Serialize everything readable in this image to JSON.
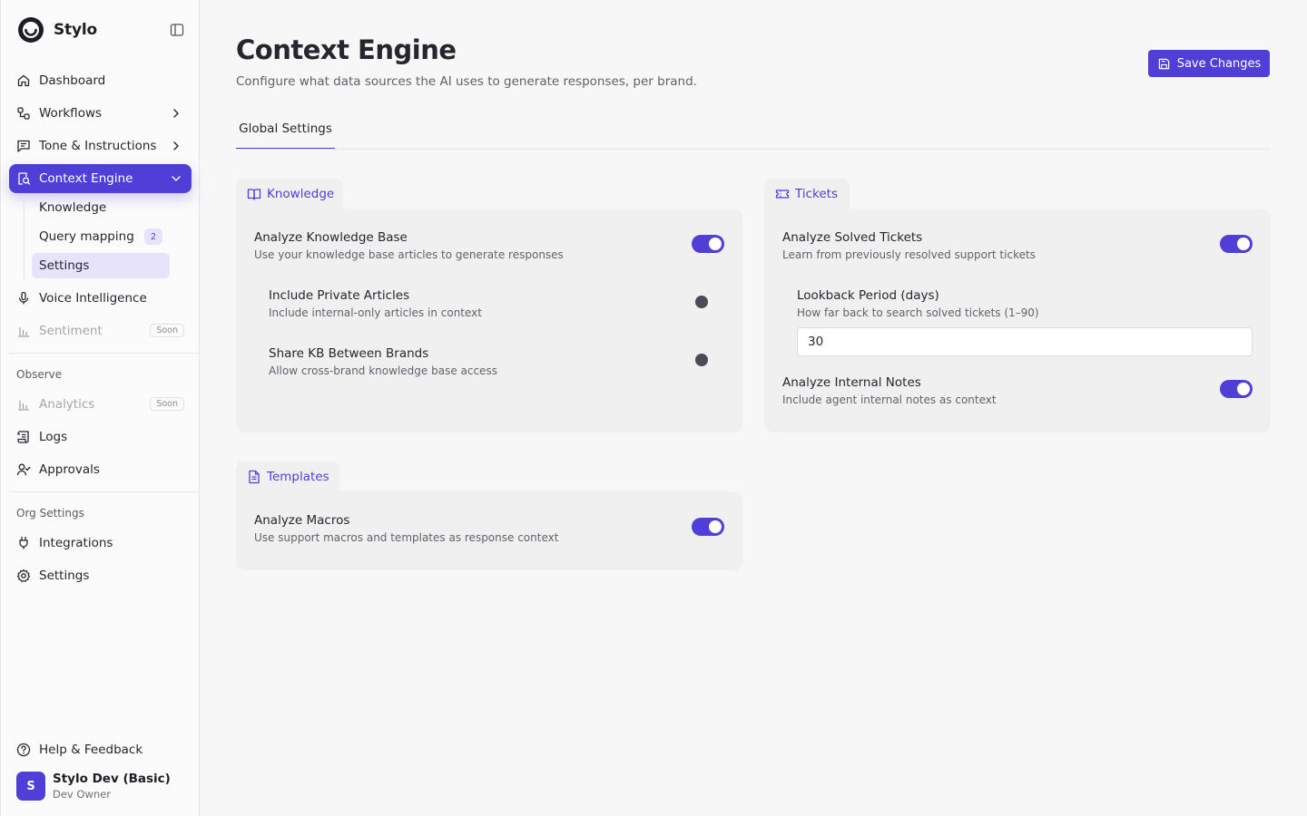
{
  "brand": {
    "name": "Stylo"
  },
  "sidebar": {
    "items": [
      {
        "label": "Dashboard"
      },
      {
        "label": "Workflows"
      },
      {
        "label": "Tone & Instructions"
      },
      {
        "label": "Context Engine"
      },
      {
        "label": "Voice Intelligence"
      },
      {
        "label": "Sentiment",
        "badge": "Soon"
      }
    ],
    "context_sub": [
      {
        "label": "Knowledge"
      },
      {
        "label": "Query mapping",
        "count": "2"
      },
      {
        "label": "Settings"
      }
    ],
    "observe_label": "Observe",
    "observe": [
      {
        "label": "Analytics",
        "badge": "Soon"
      },
      {
        "label": "Logs"
      },
      {
        "label": "Approvals"
      }
    ],
    "org_label": "Org Settings",
    "org": [
      {
        "label": "Integrations"
      },
      {
        "label": "Settings"
      }
    ],
    "help": "Help & Feedback",
    "user": {
      "initial": "S",
      "name": "Stylo Dev (Basic)",
      "role": "Dev Owner"
    }
  },
  "header": {
    "title": "Context Engine",
    "subtitle": "Configure what data sources the AI uses to generate responses, per brand.",
    "save_label": "Save Changes"
  },
  "tabs": [
    {
      "label": "Global Settings"
    }
  ],
  "knowledge": {
    "tab_label": "Knowledge",
    "settings": [
      {
        "title": "Analyze Knowledge Base",
        "desc": "Use your knowledge base articles to generate responses",
        "enabled": true
      },
      {
        "title": "Include Private Articles",
        "desc": "Include internal-only articles in context",
        "enabled": false
      },
      {
        "title": "Share KB Between Brands",
        "desc": "Allow cross-brand knowledge base access",
        "enabled": false
      }
    ]
  },
  "tickets": {
    "tab_label": "Tickets",
    "solved": {
      "title": "Analyze Solved Tickets",
      "desc": "Learn from previously resolved support tickets",
      "enabled": true
    },
    "lookback": {
      "title": "Lookback Period (days)",
      "desc": "How far back to search solved tickets (1–90)",
      "value": "30"
    },
    "notes": {
      "title": "Analyze Internal Notes",
      "desc": "Include agent internal notes as context",
      "enabled": true
    }
  },
  "templates": {
    "tab_label": "Templates",
    "macros": {
      "title": "Analyze Macros",
      "desc": "Use support macros and templates as response context",
      "enabled": true
    }
  },
  "colors": {
    "accent": "#4f3fd6",
    "accent_light": "#e6e3fb",
    "card": "#f0f0f1"
  }
}
